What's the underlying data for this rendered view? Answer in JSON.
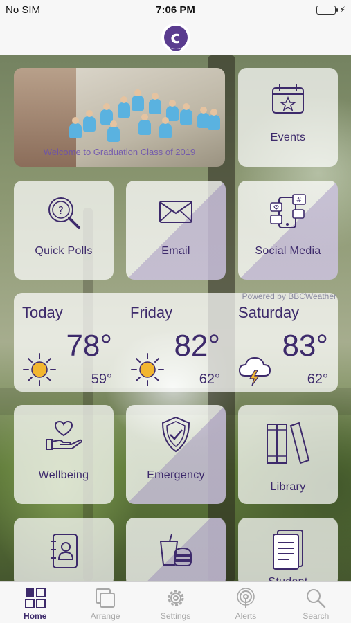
{
  "status_bar": {
    "carrier": "No SIM",
    "time": "7:06 PM"
  },
  "photo_tile": {
    "caption": "Welcome to Graduation Class of 2019"
  },
  "tiles": {
    "events": "Events",
    "quick_polls": "Quick Polls",
    "email": "Email",
    "social_media": "Social Media",
    "wellbeing": "Wellbeing",
    "emergency": "Emergency",
    "library": "Library",
    "student": "Student"
  },
  "weather": {
    "powered_by": "Powered by BBCWeather",
    "days": [
      {
        "day": "Today",
        "high": "78°",
        "low": "59°",
        "icon": "sun-icon"
      },
      {
        "day": "Friday",
        "high": "82°",
        "low": "62°",
        "icon": "sun-icon"
      },
      {
        "day": "Saturday",
        "high": "83°",
        "low": "62°",
        "icon": "thunderstorm-icon"
      }
    ]
  },
  "tabbar": {
    "home": "Home",
    "arrange": "Arrange",
    "settings": "Settings",
    "alerts": "Alerts",
    "search": "Search"
  },
  "colors": {
    "accent": "#3d2a6b",
    "tile_tint": "#cdc3e1",
    "sun": "#f2b630"
  }
}
